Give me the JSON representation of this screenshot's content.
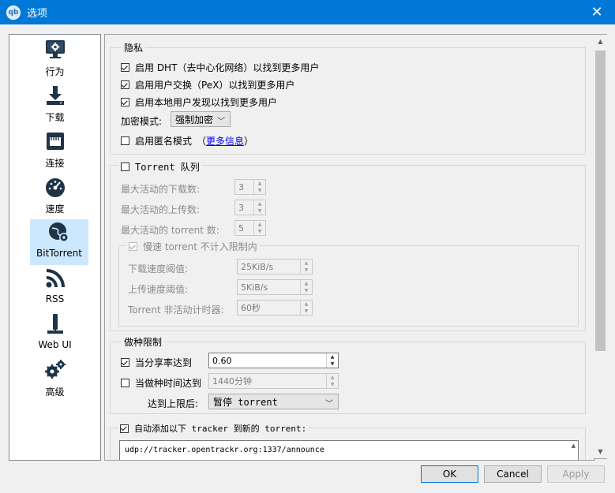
{
  "window": {
    "title": "选项",
    "app_icon_text": "qb",
    "close_icon": "close-icon"
  },
  "sidebar": {
    "items": [
      {
        "label": "行为",
        "icon": "monitor-gear-icon"
      },
      {
        "label": "下载",
        "icon": "download-icon"
      },
      {
        "label": "连接",
        "icon": "ethernet-icon"
      },
      {
        "label": "速度",
        "icon": "speedometer-icon"
      },
      {
        "label": "BitTorrent",
        "icon": "globe-gear-icon",
        "selected": true
      },
      {
        "label": "RSS",
        "icon": "rss-icon"
      },
      {
        "label": "Web UI",
        "icon": "tower-icon"
      },
      {
        "label": "高级",
        "icon": "gears-icon"
      }
    ]
  },
  "privacy": {
    "title": "隐私",
    "dht_label": "启用 DHT（去中心化网络）以找到更多用户",
    "dht_checked": true,
    "pex_label": "启用用户交换（PeX）以找到更多用户",
    "pex_checked": true,
    "lpd_label": "启用本地用户发现以找到更多用户",
    "lpd_checked": true,
    "encryption_label": "加密模式:",
    "encryption_value": "强制加密",
    "anon_label": "启用匿名模式",
    "anon_checked": false,
    "more_info_open": "（",
    "more_info_link": "更多信息",
    "more_info_close": "）"
  },
  "queue": {
    "title": "Torrent 队列",
    "checked": false,
    "max_active_downloads_label": "最大活动的下载数:",
    "max_active_downloads": "3",
    "max_active_uploads_label": "最大活动的上传数:",
    "max_active_uploads": "3",
    "max_active_torrents_label": "最大活动的 torrent 数:",
    "max_active_torrents": "5",
    "slow_title": "慢速 torrent 不计入限制内",
    "slow_checked": true,
    "download_threshold_label": "下载速度阈值:",
    "download_threshold": "25KiB/s",
    "upload_threshold_label": "上传速度阈值:",
    "upload_threshold": "5KiB/s",
    "inactivity_label": "Torrent 非活动计时器:",
    "inactivity": "60秒"
  },
  "seeding": {
    "title": "做种限制",
    "ratio_label": "当分享率达到",
    "ratio_checked": true,
    "ratio_value": "0.60",
    "time_label": "当做种时间达到",
    "time_checked": false,
    "time_value": "1440分钟",
    "action_label": "达到上限后:",
    "action_value": "暂停 torrent"
  },
  "trackers": {
    "label": "自动添加以下 tracker 到新的 torrent:",
    "checked": true,
    "value": "udp://tracker.opentrackr.org:1337/announce"
  },
  "buttons": {
    "ok": "OK",
    "cancel": "Cancel",
    "apply": "Apply"
  }
}
